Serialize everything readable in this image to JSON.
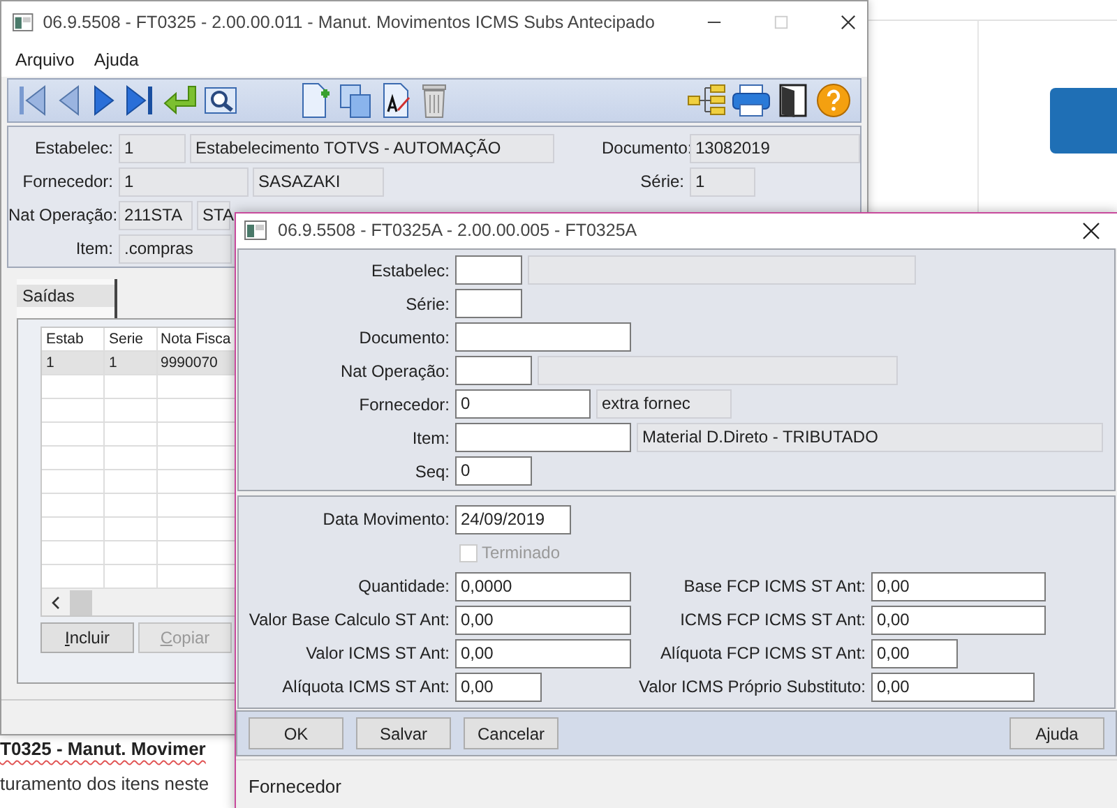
{
  "page": {
    "heading": "T0325 - Manut. Movimer",
    "text": "turamento dos itens neste"
  },
  "main_window": {
    "title": "06.9.5508 - FT0325 - 2.00.00.011 - Manut. Movimentos ICMS Subs Antecipado",
    "menu": [
      "Arquivo",
      "Ajuda"
    ],
    "header_rows": [
      {
        "label": "Estabelec:",
        "code": "1",
        "description": "Estabelecimento TOTVS - AUTOMAÇÃO",
        "right_label": "Documento:",
        "right_value": "13082019"
      },
      {
        "label": "Fornecedor:",
        "code": "1",
        "description": "SASAZAKI",
        "right_label": "Série:",
        "right_value": "1"
      },
      {
        "label": "Nat Operação:",
        "code": "211STA",
        "description": "STA"
      },
      {
        "label": "Item:",
        "code": ".compras"
      }
    ],
    "tabs": [
      {
        "label": "Saídas",
        "selected": true
      }
    ],
    "table": {
      "columns": [
        "Estab",
        "Serie",
        "Nota Fisca"
      ],
      "rows": [
        {
          "cells": [
            "1",
            "1",
            "9990070"
          ],
          "selected": true
        }
      ]
    },
    "buttons": [
      {
        "label": "Incluir",
        "disabled": false
      },
      {
        "label": "Copiar",
        "disabled": true
      }
    ]
  },
  "dialog": {
    "title": "06.9.5508 - FT0325A - 2.00.00.005 - FT0325A",
    "key_fields": [
      {
        "label": "Estabelec:",
        "description_box": true
      },
      {
        "label": "Série:"
      },
      {
        "label": "Documento:"
      },
      {
        "label": "Nat Operação:",
        "description_box": true
      },
      {
        "label": "Fornecedor:",
        "value": "0",
        "description": "extra fornec"
      },
      {
        "label": "Item:",
        "description": "Material D.Direto - TRIBUTADO"
      },
      {
        "label": "Seq:",
        "value": "0"
      }
    ],
    "date": {
      "label": "Data Movimento:",
      "value": "24/09/2019"
    },
    "terminado": {
      "label": "Terminado",
      "checked": false,
      "disabled": true
    },
    "values_left": [
      {
        "label": "Quantidade:",
        "value": "0,0000"
      },
      {
        "label": "Valor Base Calculo ST Ant:",
        "value": "0,00"
      },
      {
        "label": "Valor ICMS ST Ant:",
        "value": "0,00"
      },
      {
        "label": "Alíquota ICMS ST Ant:",
        "value": "0,00"
      }
    ],
    "values_right": [
      {
        "label": "Base FCP ICMS ST Ant:",
        "value": "0,00"
      },
      {
        "label": "ICMS FCP ICMS ST Ant:",
        "value": "0,00"
      },
      {
        "label": "Alíquota FCP ICMS ST Ant:",
        "value": "0,00"
      },
      {
        "label": "Valor ICMS Próprio Substituto:",
        "value": "0,00"
      }
    ],
    "buttons_left": [
      "OK",
      "Salvar",
      "Cancelar"
    ],
    "buttons_right": [
      "Ajuda"
    ],
    "status_bar": "Fornecedor"
  }
}
